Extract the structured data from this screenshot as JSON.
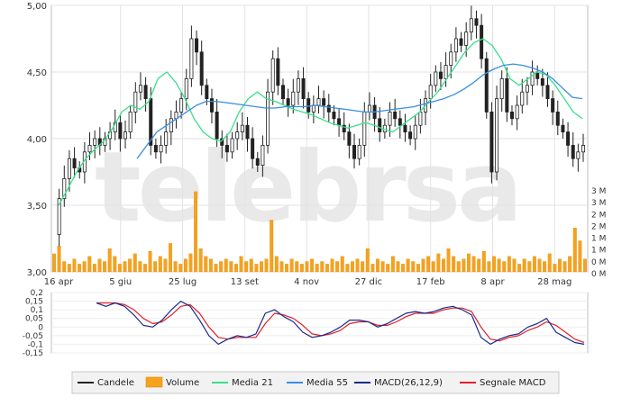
{
  "colors": {
    "candle": "#222222",
    "volume": "#f7a21b",
    "media21": "#39e08a",
    "media55": "#3a8ee0",
    "macd": "#1a2a8c",
    "signal": "#e0202a",
    "watermark": "#e9e9e9",
    "grid": "#e3e3e3",
    "legend_bg": "#f2f2f2"
  },
  "watermark": "telebrsa",
  "chart_data": [
    {
      "type": "line",
      "panel": "price",
      "y_scale": "linear",
      "ylim": [
        3.0,
        5.0
      ],
      "y_ticks": [
        "5,00",
        "4,50",
        "4,00",
        "3,50",
        "3,00"
      ],
      "x_ticks": [
        "16 apr",
        "5 giu",
        "25 lug",
        "13 set",
        "4 nov",
        "27 dic",
        "17 feb",
        "8 apr",
        "28 mag"
      ],
      "grid": true,
      "series": [
        {
          "name": "Candele",
          "style": "candlestick-close",
          "values": [
            3.28,
            3.55,
            3.7,
            3.85,
            3.78,
            3.75,
            3.9,
            3.95,
            4.0,
            3.95,
            4.0,
            4.05,
            4.12,
            4.0,
            4.05,
            4.2,
            4.35,
            4.4,
            4.3,
            3.95,
            3.9,
            3.95,
            4.05,
            4.15,
            4.2,
            4.3,
            4.45,
            4.75,
            4.65,
            4.4,
            4.3,
            4.2,
            4.0,
            3.95,
            3.9,
            4.0,
            4.05,
            4.1,
            4.0,
            3.85,
            3.8,
            3.95,
            4.35,
            4.6,
            4.4,
            4.3,
            4.25,
            4.35,
            4.45,
            4.3,
            4.2,
            4.25,
            4.3,
            4.25,
            4.2,
            4.15,
            4.1,
            4.05,
            3.95,
            3.85,
            3.95,
            4.2,
            4.25,
            4.15,
            4.05,
            4.1,
            4.2,
            4.15,
            4.1,
            4.05,
            4.0,
            4.1,
            4.2,
            4.3,
            4.4,
            4.5,
            4.45,
            4.55,
            4.65,
            4.75,
            4.7,
            4.8,
            4.9,
            4.85,
            4.6,
            4.2,
            3.75,
            4.3,
            4.45,
            4.2,
            4.15,
            4.25,
            4.35,
            4.4,
            4.5,
            4.45,
            4.4,
            4.3,
            4.2,
            4.1,
            4.05,
            3.95,
            3.85,
            3.9,
            3.95
          ]
        },
        {
          "name": "Media 21",
          "values": [
            3.5,
            3.62,
            3.75,
            3.85,
            3.92,
            3.98,
            4.08,
            4.2,
            4.25,
            4.22,
            4.28,
            4.45,
            4.5,
            4.42,
            4.3,
            4.15,
            4.05,
            4.0,
            3.98,
            4.05,
            4.2,
            4.3,
            4.35,
            4.3,
            4.28,
            4.25,
            4.22,
            4.2,
            4.18,
            4.15,
            4.12,
            4.1,
            4.08,
            4.1,
            4.12,
            4.1,
            4.07,
            4.05,
            4.1,
            4.15,
            4.2,
            4.28,
            4.35,
            4.45,
            4.55,
            4.65,
            4.72,
            4.75,
            4.7,
            4.6,
            4.45,
            4.4,
            4.45,
            4.5,
            4.48,
            4.4,
            4.3,
            4.2,
            4.15
          ]
        },
        {
          "name": "Media 55",
          "values": [
            3.85,
            3.95,
            4.05,
            4.1,
            4.15,
            4.2,
            4.25,
            4.28,
            4.28,
            4.27,
            4.26,
            4.25,
            4.24,
            4.23,
            4.23,
            4.24,
            4.24,
            4.24,
            4.25,
            4.24,
            4.23,
            4.22,
            4.21,
            4.2,
            4.2,
            4.21,
            4.22,
            4.23,
            4.24,
            4.26,
            4.28,
            4.3,
            4.33,
            4.37,
            4.42,
            4.48,
            4.52,
            4.55,
            4.56,
            4.55,
            4.53,
            4.5,
            4.45,
            4.38,
            4.31,
            4.3
          ]
        }
      ]
    },
    {
      "type": "bar",
      "panel": "volume",
      "name": "Volume",
      "y_ticks": [
        "3 M",
        "3 M",
        "2 M",
        "2 M",
        "1 M",
        "1 M",
        "0 M",
        "0 M"
      ],
      "values": [
        0.7,
        1.0,
        0.4,
        0.3,
        0.5,
        0.3,
        0.4,
        0.6,
        0.3,
        0.5,
        0.4,
        0.9,
        0.6,
        0.3,
        0.4,
        0.5,
        0.7,
        0.4,
        0.3,
        0.8,
        0.4,
        0.6,
        0.5,
        1.1,
        0.4,
        0.3,
        0.5,
        0.7,
        3.1,
        0.9,
        0.6,
        0.5,
        0.3,
        0.4,
        0.5,
        0.4,
        0.3,
        0.6,
        0.4,
        0.5,
        0.3,
        0.4,
        0.5,
        2.0,
        0.6,
        0.4,
        0.3,
        0.5,
        0.4,
        0.3,
        0.4,
        0.5,
        0.3,
        0.4,
        0.3,
        0.5,
        0.4,
        0.6,
        0.3,
        0.4,
        0.5,
        0.4,
        0.9,
        0.3,
        0.5,
        0.4,
        0.3,
        0.6,
        0.4,
        0.3,
        0.5,
        0.4,
        0.3,
        0.5,
        0.6,
        0.4,
        0.7,
        0.5,
        0.9,
        0.6,
        0.4,
        0.5,
        0.7,
        0.6,
        0.5,
        0.8,
        0.4,
        0.6,
        0.5,
        0.4,
        0.6,
        0.5,
        0.3,
        0.5,
        0.4,
        0.6,
        0.5,
        0.4,
        0.7,
        0.3,
        0.5,
        0.4,
        0.6,
        1.7,
        1.2,
        0.5
      ]
    },
    {
      "type": "line",
      "panel": "macd",
      "ylim": [
        -0.15,
        0.2
      ],
      "y_ticks": [
        "0,2",
        "0,15",
        "0,1",
        "0,05",
        "0",
        "-0,05",
        "-0,1",
        "-0,15"
      ],
      "series": [
        {
          "name": "MACD(26,12,9)",
          "values": [
            0.14,
            0.12,
            0.14,
            0.12,
            0.07,
            0.01,
            0.0,
            0.04,
            0.1,
            0.15,
            0.12,
            0.04,
            -0.05,
            -0.1,
            -0.07,
            -0.05,
            -0.06,
            -0.04,
            0.08,
            0.1,
            0.06,
            0.03,
            -0.03,
            -0.06,
            -0.05,
            -0.03,
            0.0,
            0.04,
            0.04,
            0.03,
            0.0,
            0.02,
            0.05,
            0.08,
            0.09,
            0.08,
            0.09,
            0.11,
            0.12,
            0.1,
            0.07,
            -0.06,
            -0.1,
            -0.07,
            -0.05,
            -0.04,
            0.0,
            0.02,
            0.05,
            -0.03,
            -0.06,
            -0.09,
            -0.1
          ]
        },
        {
          "name": "Segnale MACD",
          "values": [
            0.14,
            0.14,
            0.14,
            0.13,
            0.1,
            0.05,
            0.02,
            0.03,
            0.07,
            0.12,
            0.13,
            0.08,
            0.0,
            -0.06,
            -0.07,
            -0.06,
            -0.06,
            -0.06,
            0.02,
            0.08,
            0.07,
            0.05,
            0.01,
            -0.04,
            -0.05,
            -0.04,
            -0.02,
            0.02,
            0.03,
            0.03,
            0.01,
            0.01,
            0.03,
            0.06,
            0.08,
            0.08,
            0.08,
            0.1,
            0.11,
            0.11,
            0.09,
            0.0,
            -0.07,
            -0.08,
            -0.06,
            -0.05,
            -0.02,
            0.0,
            0.03,
            0.01,
            -0.03,
            -0.07,
            -0.09
          ]
        }
      ]
    }
  ],
  "legend": [
    {
      "label": "Candele",
      "swatch": "line",
      "color": "#222222"
    },
    {
      "label": "Volume",
      "swatch": "box",
      "color": "#f7a21b"
    },
    {
      "label": "Media 21",
      "swatch": "line",
      "color": "#39e08a"
    },
    {
      "label": "Media 55",
      "swatch": "line",
      "color": "#3a8ee0"
    },
    {
      "label": "MACD(26,12,9)",
      "swatch": "line",
      "color": "#1a2a8c"
    },
    {
      "label": "Segnale MACD",
      "swatch": "line",
      "color": "#e0202a"
    }
  ]
}
